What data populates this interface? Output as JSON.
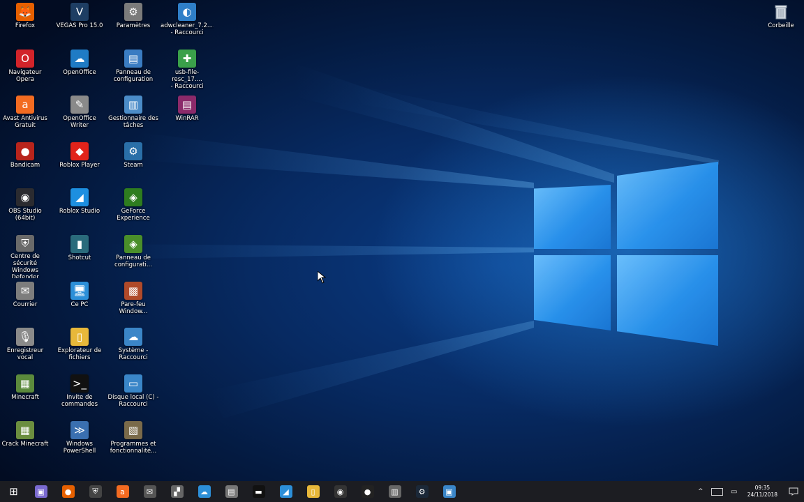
{
  "desktop": {
    "icons": [
      {
        "label": "Firefox",
        "icon": "firefox-icon",
        "color": "#e66000",
        "glyph": "🦊"
      },
      {
        "label": "Navigateur\nOpera",
        "icon": "opera-icon",
        "color": "#d2232a",
        "glyph": "O"
      },
      {
        "label": "Avast Antivirus\nGratuit",
        "icon": "avast-icon",
        "color": "#f36b21",
        "glyph": "a"
      },
      {
        "label": "Bandicam",
        "icon": "bandicam-icon",
        "color": "#b8241c",
        "glyph": "●"
      },
      {
        "label": "OBS Studio\n(64bit)",
        "icon": "obs-icon",
        "color": "#2b2b30",
        "glyph": "◉"
      },
      {
        "label": "Centre de\nsécurité\nWindows\nDefender",
        "icon": "defender-icon",
        "color": "#6a6a6a",
        "glyph": "⛨"
      },
      {
        "label": "Courrier",
        "icon": "mail-icon",
        "color": "#7d7d7d",
        "glyph": "✉"
      },
      {
        "label": "Enregistreur\nvocal",
        "icon": "voice-recorder-icon",
        "color": "#8a8a8a",
        "glyph": "🎙"
      },
      {
        "label": "Minecraft",
        "icon": "minecraft-icon",
        "color": "#5b8a3c",
        "glyph": "▦"
      },
      {
        "label": "Crack Minecraft",
        "icon": "minecraft-crack-icon",
        "color": "#6b8e3f",
        "glyph": "▦"
      },
      {
        "label": "VEGAS Pro 15.0",
        "icon": "vegas-icon",
        "color": "#1e3e63",
        "glyph": "V"
      },
      {
        "label": "OpenOffice",
        "icon": "openoffice-icon",
        "color": "#1f7bc4",
        "glyph": "☁"
      },
      {
        "label": "OpenOffice\nWriter",
        "icon": "openoffice-writer-icon",
        "color": "#8a8a8a",
        "glyph": "✎"
      },
      {
        "label": "Roblox Player",
        "icon": "roblox-icon",
        "color": "#e2231a",
        "glyph": "◆"
      },
      {
        "label": "Roblox Studio",
        "icon": "roblox-studio-icon",
        "color": "#1d8fe0",
        "glyph": "◢"
      },
      {
        "label": "Shotcut",
        "icon": "shotcut-icon",
        "color": "#2a6b7c",
        "glyph": "▮"
      },
      {
        "label": "Ce PC",
        "icon": "this-pc-icon",
        "color": "#2c8fd8",
        "glyph": "🖥"
      },
      {
        "label": "Explorateur de\nfichiers",
        "icon": "file-explorer-icon",
        "color": "#e8b83a",
        "glyph": "▯"
      },
      {
        "label": "Invite de\ncommandes",
        "icon": "cmd-icon",
        "color": "#111111",
        "glyph": ">_"
      },
      {
        "label": "Windows\nPowerShell",
        "icon": "powershell-icon",
        "color": "#3a6fb0",
        "glyph": "≫"
      },
      {
        "label": "Paramètres",
        "icon": "settings-icon",
        "color": "#7b7b7b",
        "glyph": "⚙"
      },
      {
        "label": "Panneau de\nconfiguration",
        "icon": "control-panel-icon",
        "color": "#3a7cc2",
        "glyph": "▤"
      },
      {
        "label": "Gestionnaire des\ntâches",
        "icon": "task-manager-icon",
        "color": "#4b8cc8",
        "glyph": "▥"
      },
      {
        "label": "Steam",
        "icon": "steam-icon",
        "color": "#2a6fa8",
        "glyph": "⚙"
      },
      {
        "label": "GeForce\nExperience",
        "icon": "geforce-icon",
        "color": "#2e7d1f",
        "glyph": "◈"
      },
      {
        "label": "Panneau de\nconfigurati...",
        "icon": "nvidia-panel-icon",
        "color": "#4a8f2a",
        "glyph": "◈"
      },
      {
        "label": "Pare-feu\nWindow...",
        "icon": "firewall-icon",
        "color": "#b04a2a",
        "glyph": "▩"
      },
      {
        "label": "Système -\nRaccourci",
        "icon": "system-icon",
        "color": "#3b86c8",
        "glyph": "☁"
      },
      {
        "label": "Disque local (C) -\nRaccourci",
        "icon": "drive-icon",
        "color": "#3a86c8",
        "glyph": "▭"
      },
      {
        "label": "Programmes et\nfonctionnalité...",
        "icon": "programs-icon",
        "color": "#7a6a4a",
        "glyph": "▧"
      },
      {
        "label": "adwcleaner_7.2....\n- Raccourci",
        "icon": "adwcleaner-icon",
        "color": "#2f7fc8",
        "glyph": "◐"
      },
      {
        "label": "usb-file-resc_17....\n- Raccourci",
        "icon": "usb-rescue-icon",
        "color": "#3aa04a",
        "glyph": "✚"
      },
      {
        "label": "WinRAR",
        "icon": "winrar-icon",
        "color": "#8b2a6a",
        "glyph": "▤"
      }
    ],
    "recycle_bin": {
      "label": "Corbeille",
      "icon": "recycle-bin-icon"
    }
  },
  "taskbar": {
    "buttons": [
      {
        "name": "start-button",
        "icon": "windows-logo-icon",
        "color": "#1c1d22",
        "glyph": "⊞"
      },
      {
        "name": "taskbar-app-1",
        "icon": "app-icon",
        "color": "#7a6ad0",
        "glyph": "▣"
      },
      {
        "name": "taskbar-firefox",
        "icon": "firefox-icon",
        "color": "#e66000",
        "glyph": "●"
      },
      {
        "name": "taskbar-defender",
        "icon": "shield-icon",
        "color": "#444",
        "glyph": "⛨"
      },
      {
        "name": "taskbar-avast",
        "icon": "avast-icon",
        "color": "#f36b21",
        "glyph": "a"
      },
      {
        "name": "taskbar-mail",
        "icon": "mail-icon",
        "color": "#555",
        "glyph": "✉"
      },
      {
        "name": "taskbar-app-6",
        "icon": "app-icon",
        "color": "#666",
        "glyph": "▞"
      },
      {
        "name": "taskbar-app-7",
        "icon": "app-icon",
        "color": "#2c8fd8",
        "glyph": "☁"
      },
      {
        "name": "taskbar-app-8",
        "icon": "app-icon",
        "color": "#777",
        "glyph": "▤"
      },
      {
        "name": "taskbar-cmd",
        "icon": "cmd-icon",
        "color": "#111",
        "glyph": "▬"
      },
      {
        "name": "taskbar-app-10",
        "icon": "app-icon",
        "color": "#2c8fd8",
        "glyph": "◢"
      },
      {
        "name": "taskbar-explorer",
        "icon": "folder-icon",
        "color": "#e8b83a",
        "glyph": "▯"
      },
      {
        "name": "taskbar-obs",
        "icon": "obs-icon",
        "color": "#333",
        "glyph": "◉"
      },
      {
        "name": "taskbar-bandicam",
        "icon": "record-icon",
        "color": "#222",
        "glyph": "●"
      },
      {
        "name": "taskbar-app-14",
        "icon": "app-icon",
        "color": "#666",
        "glyph": "▥"
      },
      {
        "name": "taskbar-steam",
        "icon": "steam-icon",
        "color": "#1b2838",
        "glyph": "⚙"
      },
      {
        "name": "taskbar-app-16",
        "icon": "app-icon",
        "color": "#3a86c8",
        "glyph": "▣"
      }
    ],
    "tray": {
      "time": "09:35",
      "date": "24/11/2018"
    }
  }
}
